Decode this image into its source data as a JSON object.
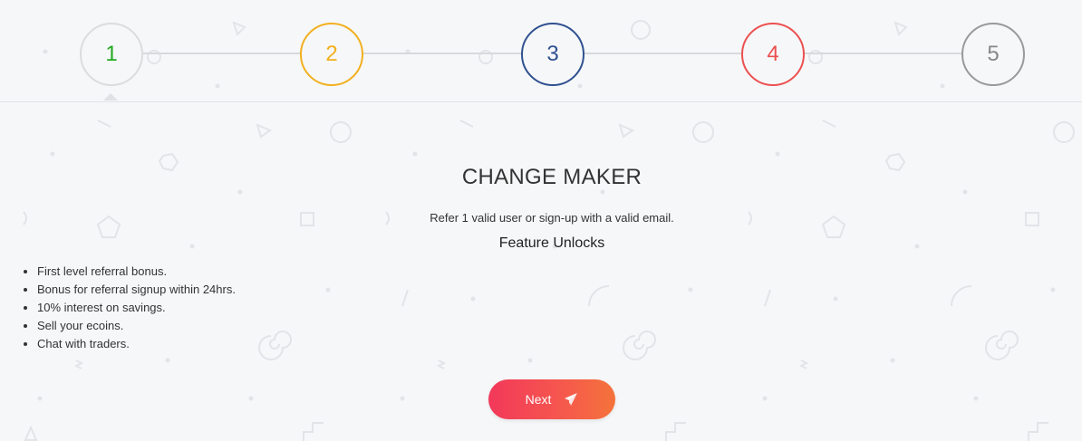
{
  "stepper": {
    "steps": [
      {
        "label": "1",
        "color": "#22aa22",
        "border": "#dcdcdc"
      },
      {
        "label": "2",
        "color": "#f2b01e",
        "border": "#f2b01e"
      },
      {
        "label": "3",
        "color": "#2f5190",
        "border": "#2f5190"
      },
      {
        "label": "4",
        "color": "#ec5050",
        "border": "#ec5050"
      },
      {
        "label": "5",
        "color": "#888888",
        "border": "#999999"
      }
    ],
    "active_step": 1
  },
  "content": {
    "title": "CHANGE MAKER",
    "description": "Refer 1 valid user or sign-up with a valid email.",
    "subtitle": "Feature Unlocks",
    "features": [
      "First level referral bonus.",
      "Bonus for referral signup within 24hrs.",
      "10% interest on savings.",
      "Sell your ecoins.",
      "Chat with traders."
    ]
  },
  "actions": {
    "next_label": "Next",
    "next_icon": "paper-plane-icon"
  }
}
